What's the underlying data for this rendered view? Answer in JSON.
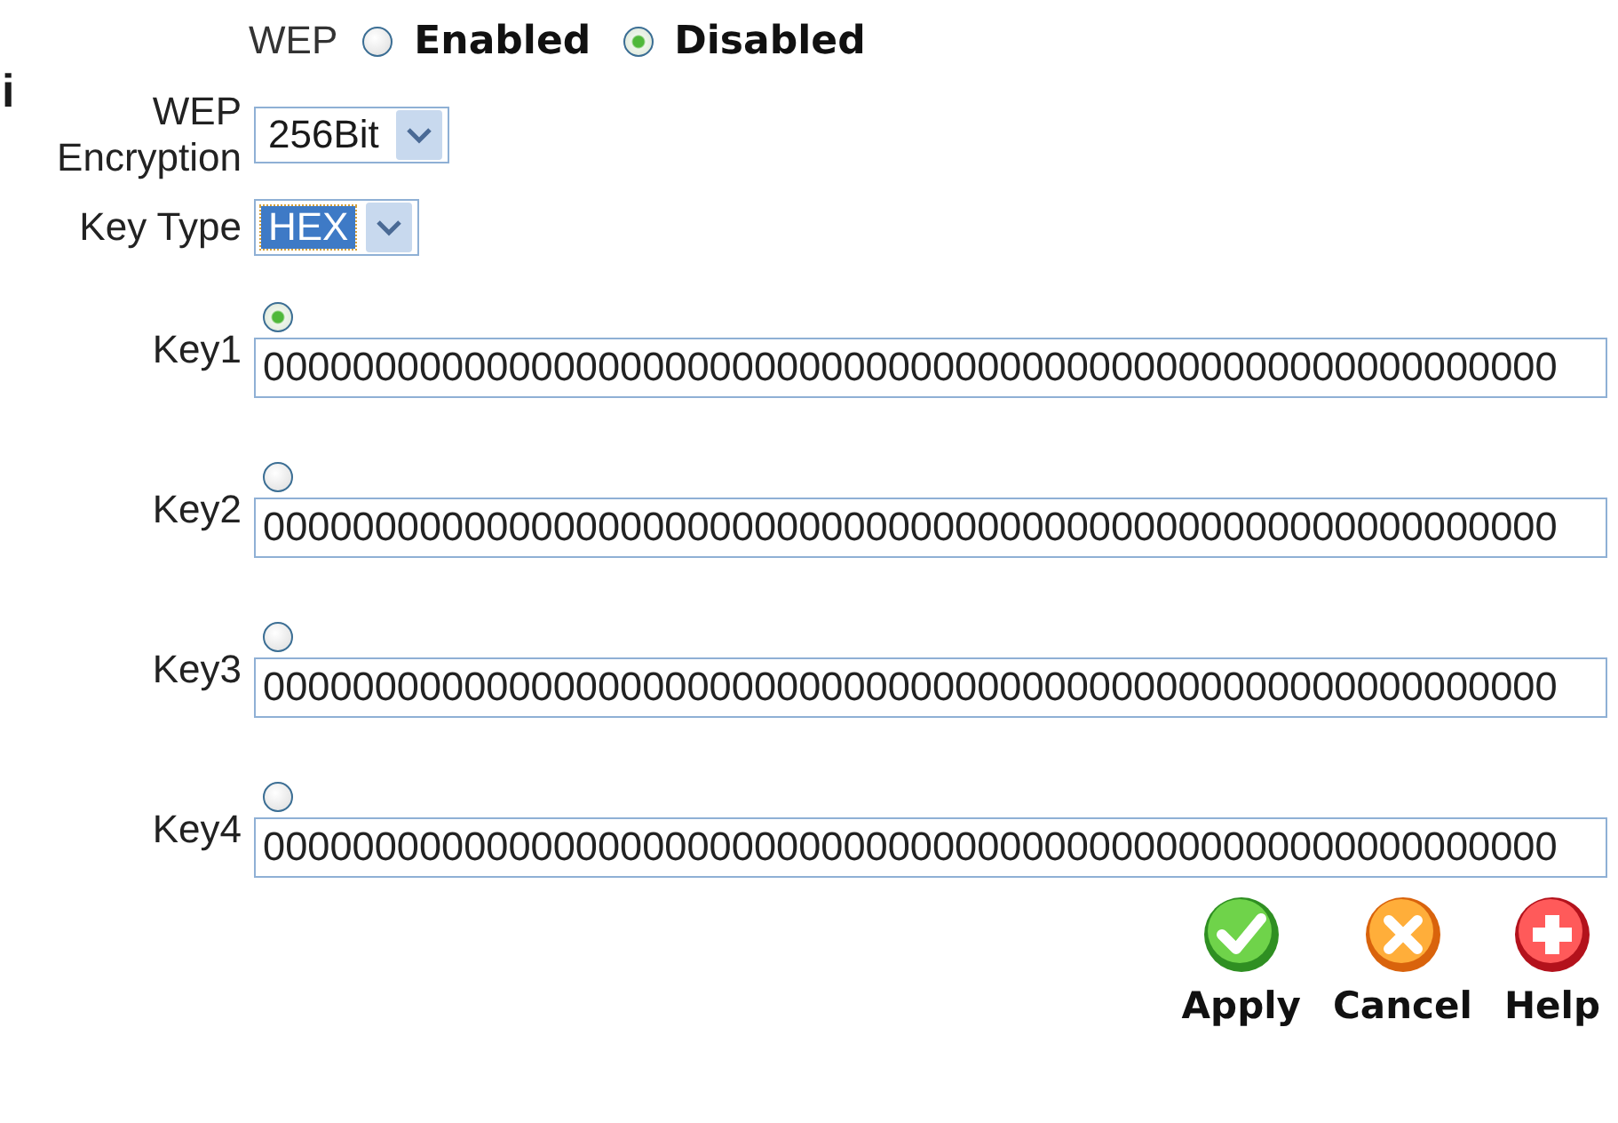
{
  "edge_text": "i",
  "wep": {
    "label": "WEP",
    "options": [
      {
        "label": "Enabled",
        "selected": false
      },
      {
        "label": "Disabled",
        "selected": true
      }
    ]
  },
  "wep_encryption": {
    "label": "WEP Encryption",
    "value": "256Bit"
  },
  "key_type": {
    "label": "Key Type",
    "value": "HEX",
    "highlighted": true
  },
  "keys": [
    {
      "label": "Key1",
      "selected": true,
      "value": "0000000000000000000000000000000000000000000000000000000000"
    },
    {
      "label": "Key2",
      "selected": false,
      "value": "0000000000000000000000000000000000000000000000000000000000"
    },
    {
      "label": "Key3",
      "selected": false,
      "value": "0000000000000000000000000000000000000000000000000000000000"
    },
    {
      "label": "Key4",
      "selected": false,
      "value": "0000000000000000000000000000000000000000000000000000000000"
    }
  ],
  "buttons": [
    {
      "label": "Apply",
      "kind": "apply"
    },
    {
      "label": "Cancel",
      "kind": "cancel"
    },
    {
      "label": "Help",
      "kind": "help"
    }
  ]
}
